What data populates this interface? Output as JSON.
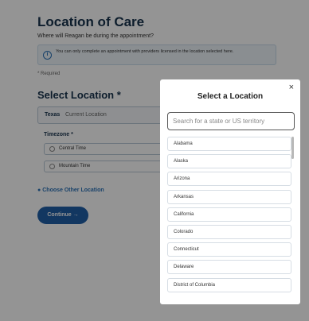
{
  "page": {
    "title": "Location of Care",
    "subtitle": "Where will Reagan be during the appointment?",
    "info": "You can only complete an appointment with providers licensed in the location selected here.",
    "required": "* Required",
    "select_heading": "Select Location *",
    "location_state": "Texas",
    "location_current": "Current Location",
    "timezone_label": "Timezone *",
    "timezones": [
      "Central Time",
      "Mountain Time"
    ],
    "choose_other": "Choose Other Location",
    "continue": "Continue →"
  },
  "modal": {
    "title": "Select a Location",
    "close": "×",
    "search_placeholder": "Search for a state or US territory",
    "items": [
      "Alabama",
      "Alaska",
      "Arizona",
      "Arkansas",
      "California",
      "Colorado",
      "Connecticut",
      "Delaware",
      "District of Columbia"
    ]
  },
  "colors": {
    "primary": "#1f5fa8",
    "heading": "#17324d",
    "overlay": "rgba(0,0,0,0.42)"
  }
}
